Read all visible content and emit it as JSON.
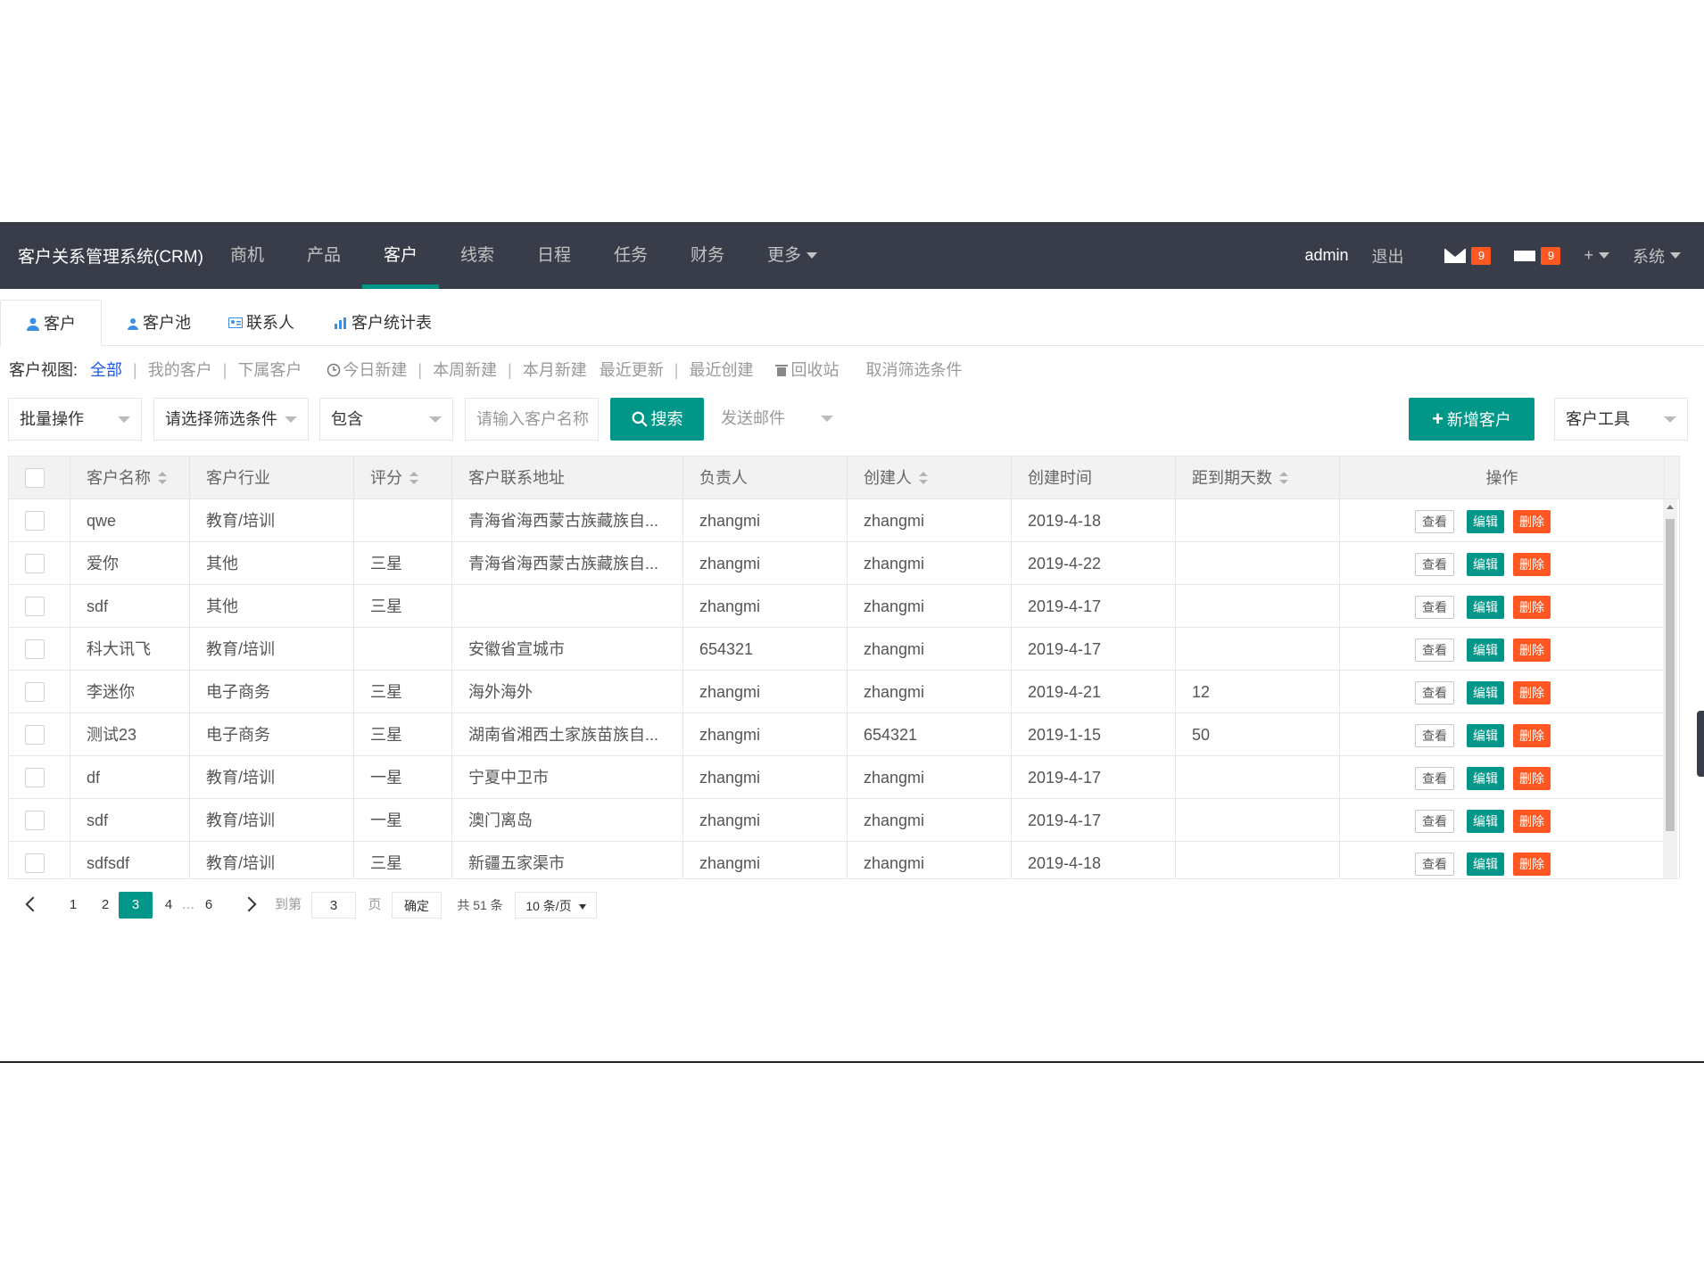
{
  "nav": {
    "brand": "客户关系管理系统(CRM)",
    "items": [
      "商机",
      "产品",
      "客户",
      "线索",
      "日程",
      "任务",
      "财务",
      "更多"
    ],
    "active_index": 2,
    "user": "admin",
    "logout": "退出",
    "mail_count": "9",
    "msg_count": "9",
    "plus": "+",
    "system": "系统"
  },
  "subtabs": [
    "客户",
    "客户池",
    "联系人",
    "客户统计表"
  ],
  "view": {
    "label": "客户视图:",
    "links": [
      "全部",
      "我的客户",
      "下属客户"
    ],
    "time_links": [
      "今日新建",
      "本周新建",
      "本月新建",
      "最近更新",
      "最近创建"
    ],
    "recycle": "回收站",
    "clear": "取消筛选条件"
  },
  "toolbar": {
    "batch": "批量操作",
    "filter": "请选择筛选条件",
    "match": "包含",
    "search_placeholder": "请输入客户名称",
    "search_btn": "搜索",
    "send_mail": "发送邮件",
    "add_btn": "新增客户",
    "tools": "客户工具"
  },
  "table": {
    "headers": [
      "客户名称",
      "客户行业",
      "评分",
      "客户联系地址",
      "负责人",
      "创建人",
      "创建时间",
      "距到期天数",
      "操作"
    ],
    "actions": {
      "view": "查看",
      "edit": "编辑",
      "delete": "删除"
    },
    "rows": [
      [
        "qwe",
        "教育/培训",
        "",
        "青海省海西蒙古族藏族自...",
        "zhangmi",
        "zhangmi",
        "2019-4-18",
        ""
      ],
      [
        "爱你",
        "其他",
        "三星",
        "青海省海西蒙古族藏族自...",
        "zhangmi",
        "zhangmi",
        "2019-4-22",
        ""
      ],
      [
        "sdf",
        "其他",
        "三星",
        "",
        "zhangmi",
        "zhangmi",
        "2019-4-17",
        ""
      ],
      [
        "科大讯飞",
        "教育/培训",
        "",
        "安徽省宣城市",
        "654321",
        "zhangmi",
        "2019-4-17",
        ""
      ],
      [
        "李迷你",
        "电子商务",
        "三星",
        "海外海外",
        "zhangmi",
        "zhangmi",
        "2019-4-21",
        "12"
      ],
      [
        "测试23",
        "电子商务",
        "三星",
        "湖南省湘西土家族苗族自...",
        "zhangmi",
        "654321",
        "2019-1-15",
        "50"
      ],
      [
        "df",
        "教育/培训",
        "一星",
        "宁夏中卫市",
        "zhangmi",
        "zhangmi",
        "2019-4-17",
        ""
      ],
      [
        "sdf",
        "教育/培训",
        "一星",
        "澳门离岛",
        "zhangmi",
        "zhangmi",
        "2019-4-17",
        ""
      ],
      [
        "sdfsdf",
        "教育/培训",
        "三星",
        "新疆五家渠市",
        "zhangmi",
        "zhangmi",
        "2019-4-18",
        ""
      ]
    ]
  },
  "pager": {
    "pages": [
      "1",
      "2",
      "3",
      "4",
      "…",
      "6"
    ],
    "current": "3",
    "goto_label": "到第",
    "goto_value": "3",
    "page_unit": "页",
    "confirm": "确定",
    "total": "共 51 条",
    "per_page": "10 条/页"
  },
  "colors": {
    "nav_bg": "#393d49",
    "accent": "#009688",
    "danger": "#ff5722",
    "link": "#1e59e6"
  }
}
